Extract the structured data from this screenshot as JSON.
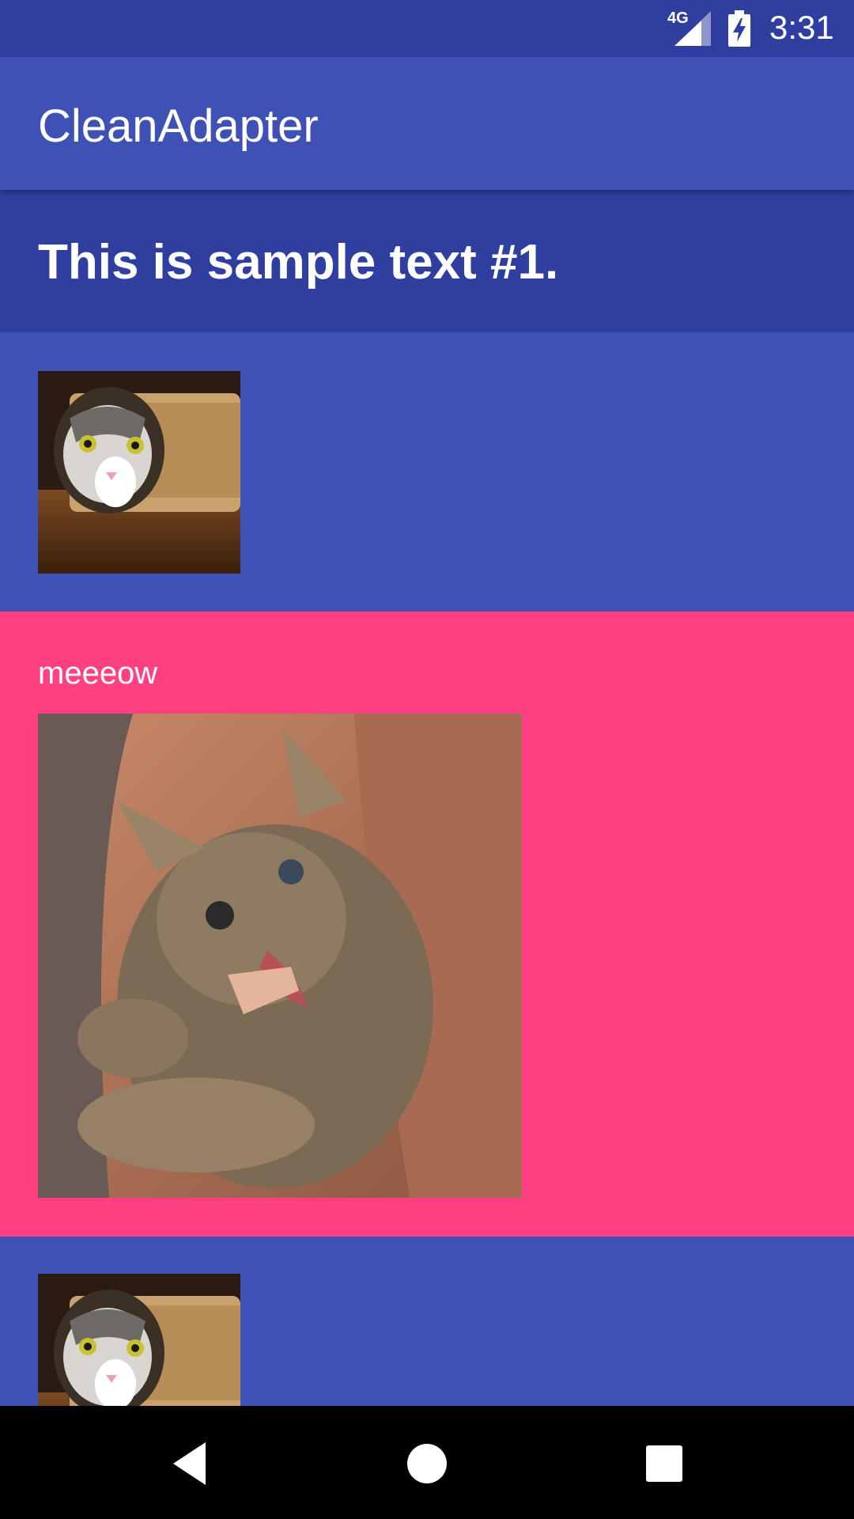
{
  "status_bar": {
    "network_label": "4G",
    "time": "3:31",
    "icons": [
      "signal-icon",
      "battery-charging-icon"
    ]
  },
  "app_bar": {
    "title": "CleanAdapter"
  },
  "list": {
    "header_text": "This is sample text #1.",
    "pink_caption": "meeeow",
    "items": [
      {
        "type": "image",
        "image": "cat-in-paper-roll"
      },
      {
        "type": "caption-image",
        "image": "kitten-biting-finger"
      },
      {
        "type": "image",
        "image": "cat-in-paper-roll"
      }
    ]
  },
  "nav_bar": {
    "buttons": [
      "back-icon",
      "home-icon",
      "recents-icon"
    ]
  },
  "colors": {
    "primary": "#3F51B5",
    "primary_dark": "#303F9F",
    "accent": "#FF4081",
    "nav": "#000000"
  }
}
